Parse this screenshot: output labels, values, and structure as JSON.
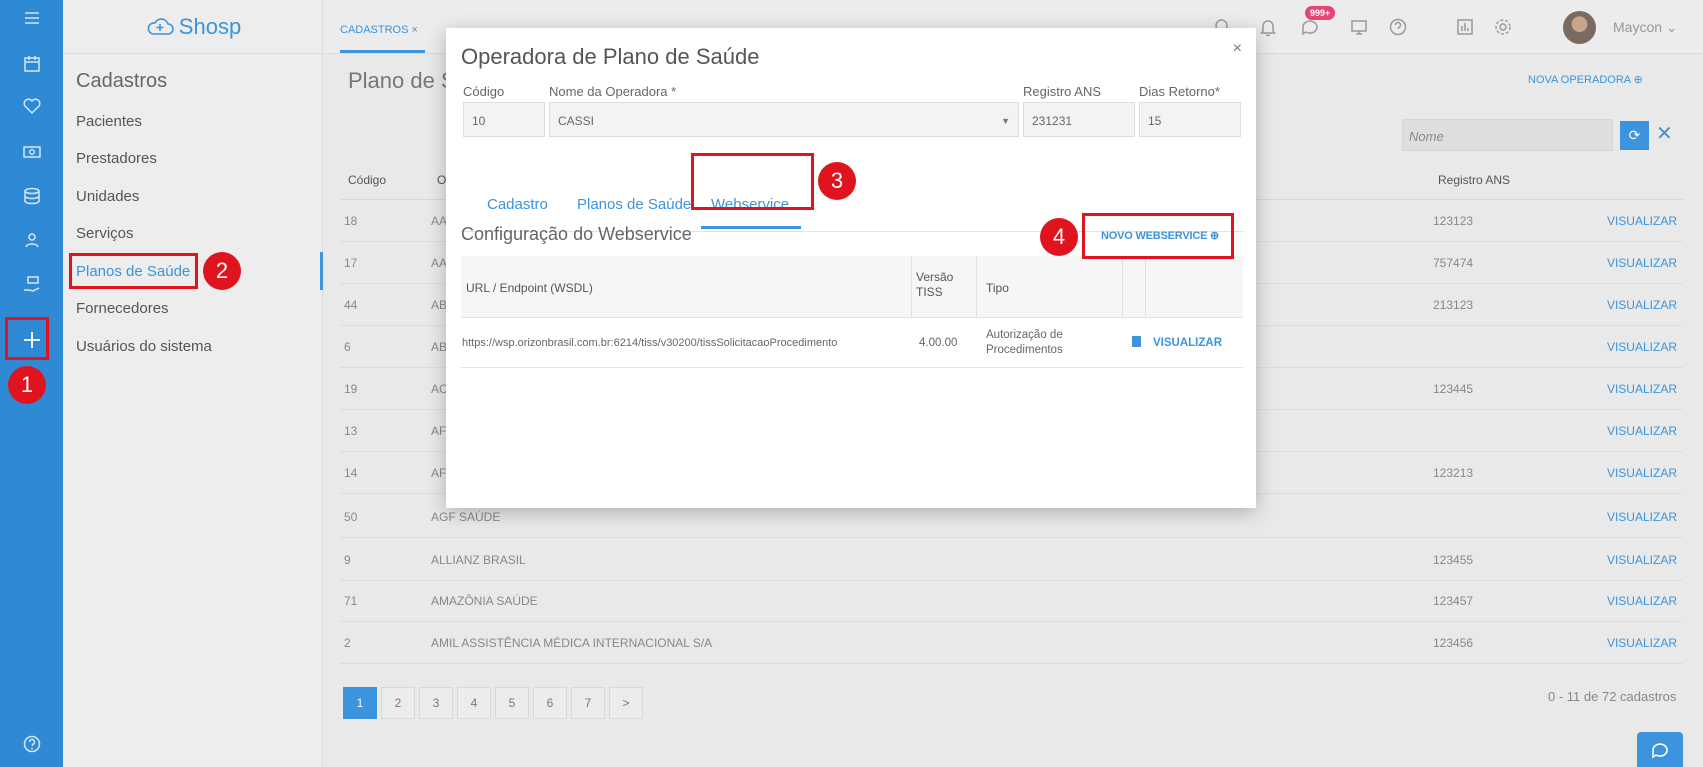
{
  "brand": {
    "name": "Shosp"
  },
  "sidebar": {
    "title": "Cadastros",
    "items": [
      {
        "label": "Pacientes"
      },
      {
        "label": "Prestadores"
      },
      {
        "label": "Unidades"
      },
      {
        "label": "Serviços"
      },
      {
        "label": "Planos de Saúde"
      },
      {
        "label": "Fornecedores"
      },
      {
        "label": "Usuários do sistema"
      }
    ]
  },
  "rail_icons": [
    "menu-icon",
    "calendar-icon",
    "heart-icon",
    "money-icon",
    "database-icon",
    "settings-people-icon",
    "hand-money-icon",
    "plus-icon",
    "help-icon"
  ],
  "header": {
    "tab_label": "CADASTROS ×",
    "notification_badge": "999+",
    "user_name": "Maycon"
  },
  "main": {
    "page_title": "Plano de S",
    "new_button": "NOVA OPERADORA ⊕",
    "filter_placeholder": "Nome",
    "columns": {
      "code": "Código",
      "name": "O",
      "ans": "Registro ANS"
    },
    "rows": [
      {
        "code": "18",
        "name": "AA",
        "ans": "123123",
        "action": "VISUALIZAR"
      },
      {
        "code": "17",
        "name": "AA",
        "ans": "757474",
        "action": "VISUALIZAR"
      },
      {
        "code": "44",
        "name": "AB",
        "ans": "213123",
        "action": "VISUALIZAR"
      },
      {
        "code": "6",
        "name": "AB",
        "ans": "",
        "action": "VISUALIZAR"
      },
      {
        "code": "19",
        "name": "AC",
        "ans": "123445",
        "action": "VISUALIZAR"
      },
      {
        "code": "13",
        "name": "AF",
        "ans": "",
        "action": "VISUALIZAR"
      },
      {
        "code": "14",
        "name": "AF",
        "ans": "123213",
        "action": "VISUALIZAR"
      },
      {
        "code": "50",
        "name": "AGF SAÚDE",
        "ans": "",
        "action": "VISUALIZAR"
      },
      {
        "code": "9",
        "name": "ALLIANZ BRASIL",
        "ans": "123455",
        "action": "VISUALIZAR"
      },
      {
        "code": "71",
        "name": "AMAZÔNIA SAÚDE",
        "ans": "123457",
        "action": "VISUALIZAR"
      },
      {
        "code": "2",
        "name": "AMIL ASSISTÊNCIA MÉDICA INTERNACIONAL S/A",
        "ans": "123456",
        "action": "VISUALIZAR"
      }
    ],
    "pages": [
      "1",
      "2",
      "3",
      "4",
      "5",
      "6",
      "7",
      ">"
    ],
    "count_info": "0 - 11 de 72 cadastros"
  },
  "modal": {
    "title": "Operadora de Plano de Saúde",
    "close": "×",
    "fields": {
      "code_label": "Código",
      "code_value": "10",
      "name_label": "Nome da Operadora *",
      "name_value": "CASSI",
      "ans_label": "Registro ANS",
      "ans_value": "231231",
      "days_label": "Dias Retorno*",
      "days_value": "15"
    },
    "tabs": [
      "Cadastro",
      "Planos de Saúde",
      "Webservice"
    ],
    "section_title": "Configuração do Webservice",
    "new_webservice": "NOVO WEBSERVICE ⊕",
    "ws_columns": {
      "url": "URL / Endpoint (WSDL)",
      "version": "Versão TISS",
      "type": "Tipo"
    },
    "ws_row": {
      "url": "https://wsp.orizonbrasil.com.br:6214/tiss/v30200/tissSolicitacaoProcedimento",
      "version": "4.00.00",
      "type": "Autorização de Procedimentos",
      "action": "VISUALIZAR"
    }
  },
  "annotations": [
    "1",
    "2",
    "3",
    "4"
  ],
  "colors": {
    "accent": "#3b94dd",
    "rail": "#2f8ad6",
    "callout": "#e0141e",
    "badge": "#e64573"
  }
}
